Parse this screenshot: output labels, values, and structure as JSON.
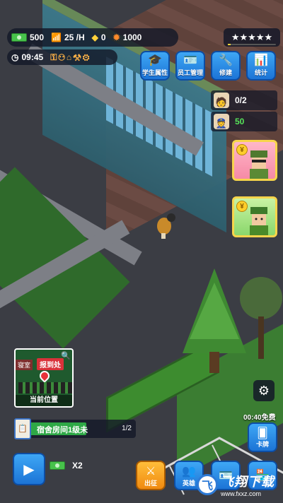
{
  "hud": {
    "cash": "500",
    "rate": "25 /H",
    "gems": "0",
    "points": "1000",
    "stars": "★★★★★",
    "time": "09:45",
    "tool_icons": [
      "key-icon",
      "people-icon",
      "basket-icon",
      "box-icon",
      "gear-icon"
    ]
  },
  "menu": [
    {
      "label": "学生属性",
      "icon": "graduation-cap-icon"
    },
    {
      "label": "员工管理",
      "icon": "id-badge-icon"
    },
    {
      "label": "修建",
      "icon": "wrench-icon"
    },
    {
      "label": "统计",
      "icon": "bar-chart-icon"
    }
  ],
  "staff": {
    "student_count": "0/2",
    "guard_count": "50"
  },
  "cards": [
    {
      "icon": "yen-coin-icon",
      "role": "sunglasses-soldier"
    },
    {
      "icon": "yen-coin-icon",
      "role": "soldier"
    }
  ],
  "minimap": {
    "tag_left": "寝室",
    "tag_main": "报到处",
    "caption": "当前位置"
  },
  "task": {
    "label": "宿舍房间1级未",
    "progress": "1/2",
    "progress_fraction": 0.5
  },
  "side": {
    "free_timer": "00:40免费",
    "card_label": "卡牌"
  },
  "bottom": {
    "multiplier": "X2",
    "buttons": [
      {
        "label": "出征",
        "icon": "crossed-swords-icon",
        "color": "orange"
      },
      {
        "label": "英雄",
        "icon": "people-icon",
        "color": "blue"
      },
      {
        "label": "",
        "icon": "id-badge-icon",
        "color": "blue"
      },
      {
        "label": "",
        "icon": "shop-icon",
        "color": "blue"
      }
    ]
  },
  "watermark": {
    "logo": "飞",
    "title": "飞翔下载",
    "url": "www.fxxz.com"
  },
  "colors": {
    "accent_blue": "#1c74d6",
    "accent_orange": "#f08a10",
    "cash_green": "#47c24b",
    "progress_green": "#2ea846"
  }
}
